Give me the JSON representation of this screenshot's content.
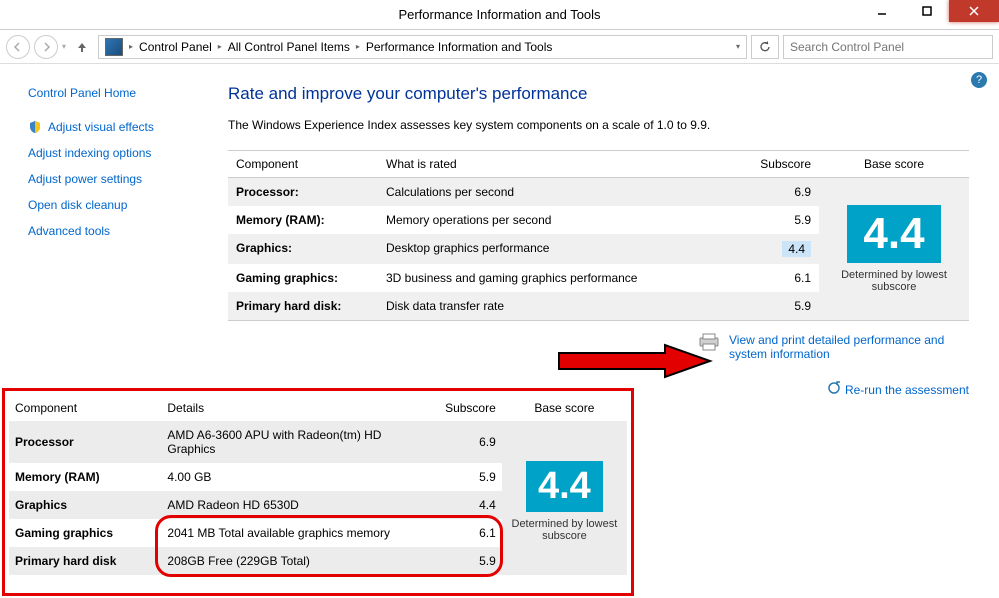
{
  "window": {
    "title": "Performance Information and Tools"
  },
  "breadcrumbs": [
    "Control Panel",
    "All Control Panel Items",
    "Performance Information and Tools"
  ],
  "search": {
    "placeholder": "Search Control Panel"
  },
  "sidebar": {
    "home": "Control Panel Home",
    "items": [
      "Adjust visual effects",
      "Adjust indexing options",
      "Adjust power settings",
      "Open disk cleanup",
      "Advanced tools"
    ]
  },
  "heading": "Rate and improve your computer's performance",
  "subhead": "The Windows Experience Index assesses key system components on a scale of 1.0 to 9.9.",
  "table_headers": {
    "component": "Component",
    "rated": "What is rated",
    "subscore": "Subscore",
    "base": "Base score"
  },
  "rows": [
    {
      "component": "Processor:",
      "rated": "Calculations per second",
      "sub": "6.9"
    },
    {
      "component": "Memory (RAM):",
      "rated": "Memory operations per second",
      "sub": "5.9"
    },
    {
      "component": "Graphics:",
      "rated": "Desktop graphics performance",
      "sub": "4.4",
      "highlight": true
    },
    {
      "component": "Gaming graphics:",
      "rated": "3D business and gaming graphics performance",
      "sub": "6.1"
    },
    {
      "component": "Primary hard disk:",
      "rated": "Disk data transfer rate",
      "sub": "5.9"
    }
  ],
  "base_score": "4.4",
  "base_caption": "Determined by lowest subscore",
  "links": {
    "view_print": "View and print detailed performance and system information",
    "rerun": "Re-run the assessment"
  },
  "detail_headers": {
    "component": "Component",
    "details": "Details",
    "subscore": "Subscore",
    "base": "Base score"
  },
  "detail_rows": [
    {
      "component": "Processor",
      "details": "AMD A6-3600 APU with Radeon(tm) HD Graphics",
      "sub": "6.9"
    },
    {
      "component": "Memory (RAM)",
      "details": "4.00 GB",
      "sub": "5.9"
    },
    {
      "component": "Graphics",
      "details": "AMD Radeon HD 6530D",
      "sub": "4.4"
    },
    {
      "component": "Gaming graphics",
      "details": "2041 MB Total available graphics memory",
      "sub": "6.1"
    },
    {
      "component": "Primary hard disk",
      "details": "208GB Free (229GB Total)",
      "sub": "5.9"
    }
  ],
  "detail_base_score": "4.4",
  "detail_base_caption": "Determined by lowest subscore"
}
